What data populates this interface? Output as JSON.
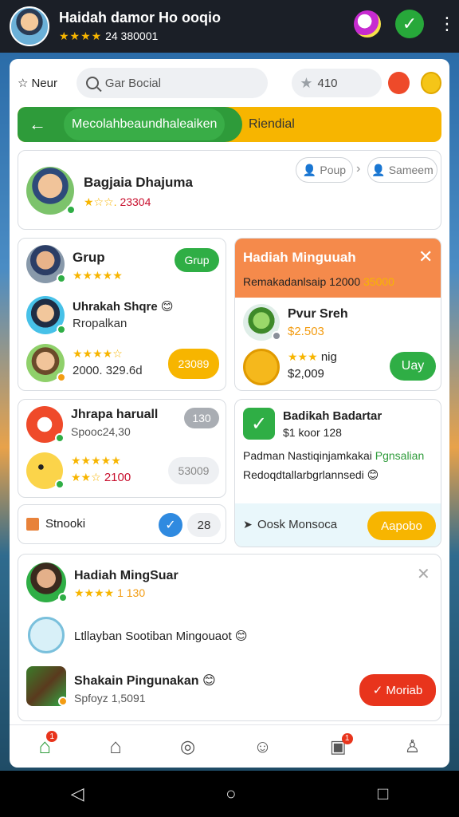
{
  "topbar": {
    "title": "Haidah damor Ho ooqio",
    "stars": "★★★★",
    "sub": "24 380001"
  },
  "toolbar": {
    "new_label": "Neur",
    "search_placeholder": "Gar Bocial",
    "score": "410"
  },
  "banner": {
    "title": "Mecolahbeaundhaleaiken",
    "right_label": "Riendial"
  },
  "profile": {
    "name": "Bagjaia Dhajuma",
    "stars": "★☆☆.",
    "score": "23304",
    "btn1": "Poup",
    "btn2": "Sameem"
  },
  "group_card": {
    "title": "Grup",
    "stars": "★★★★★",
    "btn": "Grup",
    "item2_name": "Uhrakah Shqre",
    "item2_sub": "Rropalkan",
    "item3_stars": "★★★★☆",
    "item3_sub": "2000. 329.6d",
    "item3_btn": "23089"
  },
  "reward_card": {
    "title": "Hadiah Minguuah",
    "sub": "Remakadanlsaip 12000",
    "sub_value": "35000",
    "item1_name": "Pvur Sreh",
    "item1_value": "$2.503",
    "item2_name": "nig",
    "item2_stars": "★★★",
    "item2_value": "$2,009",
    "item2_btn": "Uay"
  },
  "mid_left": {
    "item1_name": "Jhrapa haruall",
    "item1_sub": "Spooc24,30",
    "item1_badge": "130",
    "item2_stars": "★★★★★",
    "item2_sub_stars": "★★☆",
    "item2_value": "2100",
    "item2_badge": "53009"
  },
  "snooki": {
    "label": "Stnooki",
    "count": "28"
  },
  "mid_right": {
    "title": "Badikah Badartar",
    "sub": "$1 koor 128",
    "line1": "Padman Nastiqinjamkakai",
    "line1_green": "Pgnsalian",
    "line2": "Redoqdtallarbgrlannsedi",
    "search_label": "Oosk Monsoca",
    "btn": "Aapobo"
  },
  "bottom_card": {
    "item1_name": "Hadiah MingSuar",
    "item1_stars": "★★★★",
    "item1_value": "1 130",
    "item2_name": "Ltllayban Sootiban Mingouaot",
    "item3_name": "Shakain Pingunakan",
    "item3_sub": "Spfoyz 1,5091",
    "item3_btn": "Moriab"
  },
  "bottom_nav": {
    "home_badge": "1",
    "gift_badge": "1"
  }
}
